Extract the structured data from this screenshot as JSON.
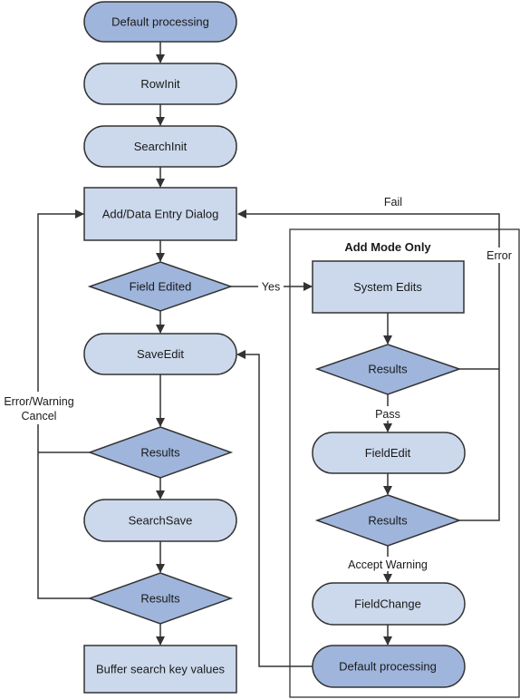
{
  "colors": {
    "light_fill": "#ccd9ec",
    "dark_fill": "#9fb5dc",
    "stroke": "#333333"
  },
  "left_flow": {
    "default_processing": "Default processing",
    "rowinit": "RowInit",
    "searchinit": "SearchInit",
    "add_data_entry_dialog": "Add/Data Entry Dialog",
    "field_edited": "Field Edited",
    "saveedit": "SaveEdit",
    "results_saveedit": "Results",
    "searchsave": "SearchSave",
    "results_searchsave": "Results",
    "buffer_search_key_values": "Buffer search key values"
  },
  "right_panel": {
    "title": "Add Mode Only",
    "system_edits": "System Edits",
    "results_system_edits": "Results",
    "fieldedit": "FieldEdit",
    "results_fieldedit": "Results",
    "fieldchange": "FieldChange",
    "default_processing": "Default processing"
  },
  "edge_labels": {
    "yes": "Yes",
    "fail": "Fail",
    "error": "Error",
    "pass": "Pass",
    "accept_warning": "Accept Warning",
    "error_warning_line1": "Error/Warning",
    "error_warning_line2": "Cancel"
  }
}
